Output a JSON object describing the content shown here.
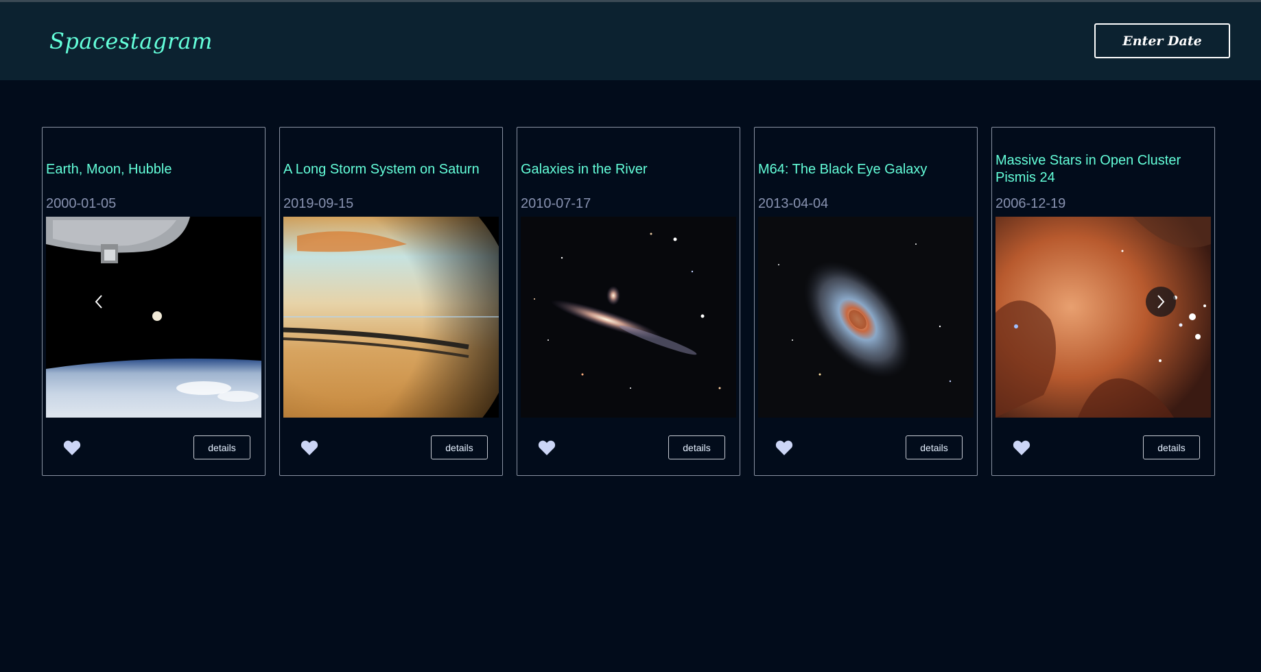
{
  "app": {
    "logo": "Spacestagram",
    "enter_date_label": "Enter Date"
  },
  "cards": [
    {
      "title": "Earth, Moon, Hubble",
      "date": "2000-01-05",
      "details_label": "details",
      "image": "earth-moon-hubble-photo"
    },
    {
      "title": "A Long Storm System on Saturn",
      "date": "2019-09-15",
      "details_label": "details",
      "image": "saturn-storm-photo"
    },
    {
      "title": "Galaxies in the River",
      "date": "2010-07-17",
      "details_label": "details",
      "image": "galaxies-river-photo"
    },
    {
      "title": "M64: The Black Eye Galaxy",
      "date": "2013-04-04",
      "details_label": "details",
      "image": "black-eye-galaxy-photo"
    },
    {
      "title": "Massive Stars in Open Cluster Pismis 24",
      "date": "2006-12-19",
      "details_label": "details",
      "image": "pismis-24-photo"
    }
  ],
  "icons": {
    "like": "heart-icon",
    "prev": "chevron-left-icon",
    "next": "chevron-right-icon"
  },
  "colors": {
    "background": "#020c1b",
    "header": "#0c2230",
    "accent": "#64ffda",
    "date_text": "#8892b0",
    "heart": "#ccd6f6"
  }
}
